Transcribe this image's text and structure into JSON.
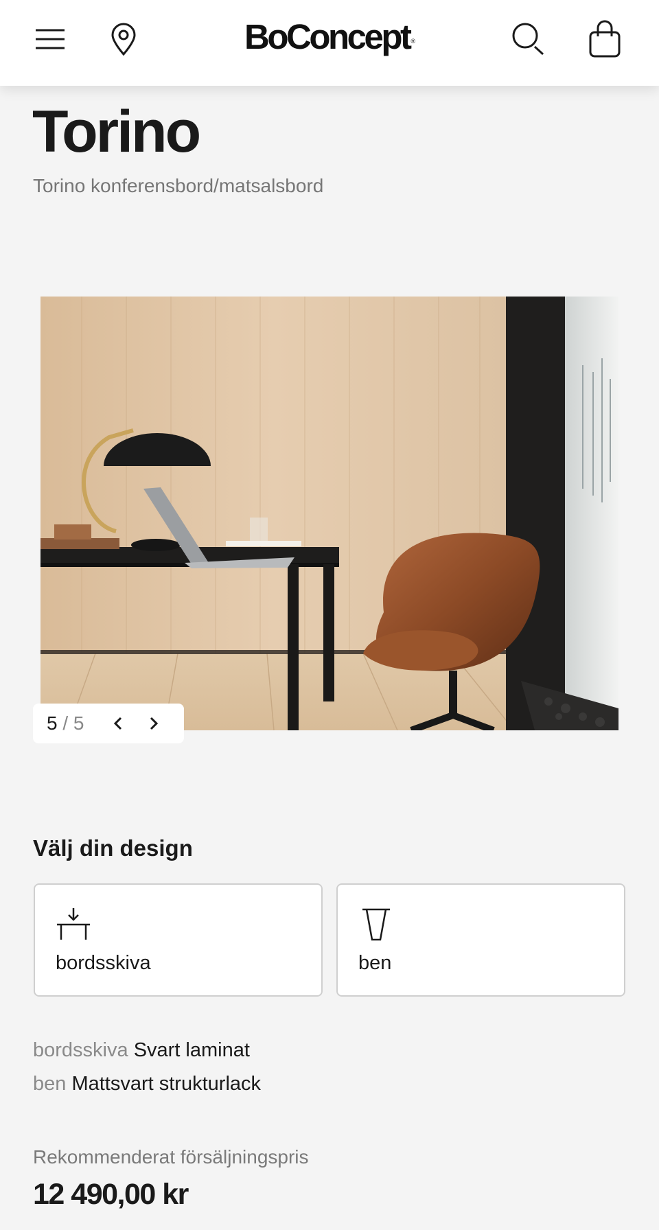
{
  "header": {
    "brand": "BoConcept",
    "brand_mark": "®",
    "icons": [
      "menu-icon",
      "location-pin-icon",
      "search-icon",
      "shopping-bag-icon"
    ]
  },
  "product": {
    "name": "Torino",
    "subtitle": "Torino konferensbord/matsalsbord"
  },
  "gallery": {
    "current": "5",
    "separator": "/",
    "total": "5",
    "prev_icon": "chevron-left-icon",
    "next_icon": "chevron-right-icon"
  },
  "design": {
    "heading": "Välj din design",
    "options": [
      {
        "label": "bordsskiva",
        "icon": "tabletop-icon"
      },
      {
        "label": "ben",
        "icon": "table-leg-icon"
      }
    ]
  },
  "selection": [
    {
      "key": "bordsskiva",
      "value": "Svart laminat"
    },
    {
      "key": "ben",
      "value": "Mattsvart strukturlack"
    }
  ],
  "price": {
    "label": "Rekommenderat försäljningspris",
    "value": "12 490,00 kr"
  },
  "colors": {
    "background": "#f4f4f4",
    "header_bg": "#ffffff",
    "text": "#1a1a1a",
    "muted": "#767676"
  }
}
